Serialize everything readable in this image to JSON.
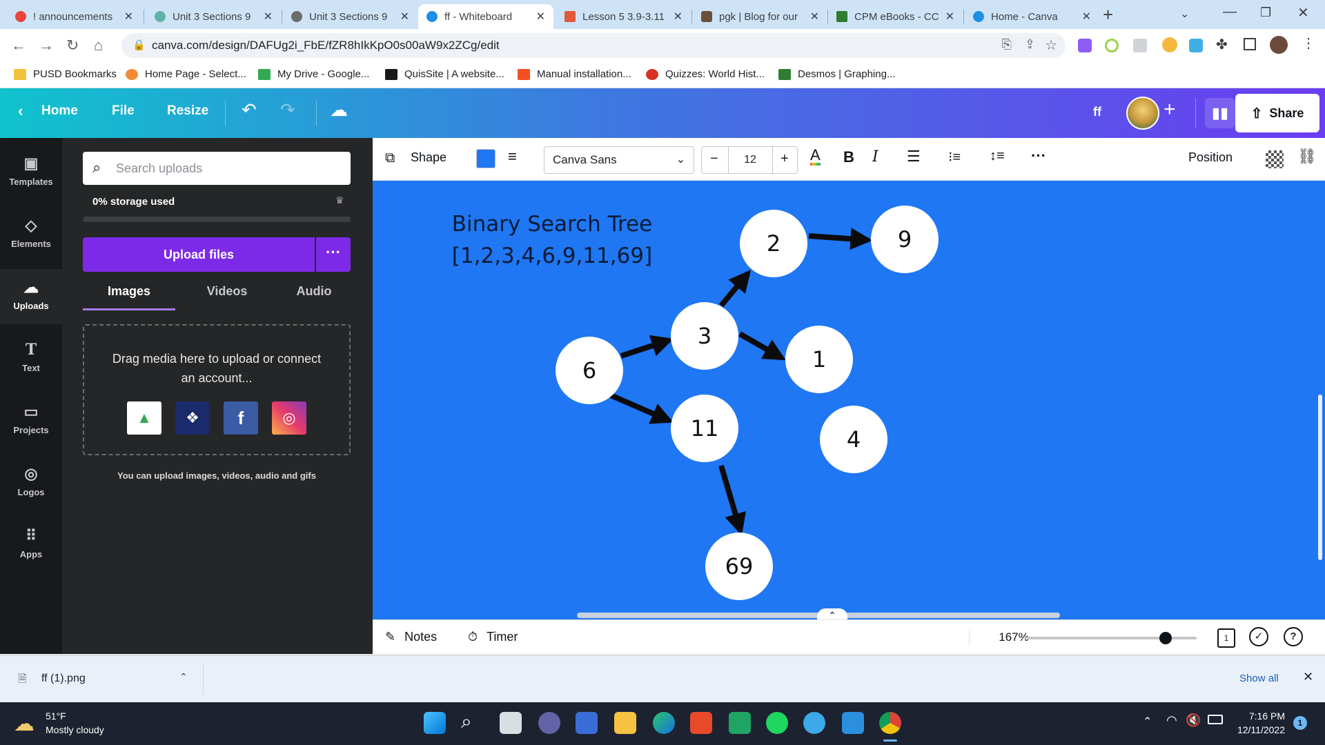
{
  "browser": {
    "tabs": [
      {
        "title": "! announcements",
        "active": false,
        "color": "#e8453c"
      },
      {
        "title": "Unit 3 Sections 9",
        "active": false,
        "color": "#5fb3a6"
      },
      {
        "title": "Unit 3 Sections 9",
        "active": false,
        "color": "#6b6b6b"
      },
      {
        "title": "ff - Whiteboard",
        "active": true,
        "color": "#1f8ee6"
      },
      {
        "title": "Lesson 5 3.9-3.11",
        "active": false,
        "color": "#e05a3a"
      },
      {
        "title": "pgk | Blog for our",
        "active": false,
        "color": "#6b4f3a"
      },
      {
        "title": "CPM eBooks - CC",
        "active": false,
        "color": "#2e7d32"
      },
      {
        "title": "Home - Canva",
        "active": false,
        "color": "#1f8ee6"
      }
    ],
    "new_tab": "+",
    "url": "canva.com/design/DAFUg2i_FbE/fZR8hIkKpO0s00aW9x2ZCg/edit",
    "bookmarks": [
      {
        "label": "PUSD Bookmarks",
        "color": "#f0c23b"
      },
      {
        "label": "Home Page - Select...",
        "color": "#f28b33"
      },
      {
        "label": "My Drive - Google...",
        "color": "#34a853"
      },
      {
        "label": "QuisSite | A website...",
        "color": "#1a1a1a"
      },
      {
        "label": "Manual installation...",
        "color": "#f25022"
      },
      {
        "label": "Quizzes: World Hist...",
        "color": "#d93025"
      },
      {
        "label": "Desmos | Graphing...",
        "color": "#2e7d32"
      }
    ]
  },
  "canva": {
    "header": {
      "home": "Home",
      "file": "File",
      "resize": "Resize",
      "doc_title": "ff",
      "share": "Share"
    },
    "rail": [
      {
        "label": "Templates",
        "icon": "templates-icon",
        "glyph": "▣"
      },
      {
        "label": "Elements",
        "icon": "elements-icon",
        "glyph": "◇"
      },
      {
        "label": "Uploads",
        "icon": "uploads-icon",
        "glyph": "☁",
        "selected": true
      },
      {
        "label": "Text",
        "icon": "text-icon",
        "glyph": "T"
      },
      {
        "label": "Projects",
        "icon": "projects-icon",
        "glyph": "▭"
      },
      {
        "label": "Logos",
        "icon": "logos-icon",
        "glyph": "◎"
      },
      {
        "label": "Apps",
        "icon": "apps-icon",
        "glyph": "⠿"
      }
    ],
    "panel": {
      "search_placeholder": "Search uploads",
      "storage": "0% storage used",
      "upload_button": "Upload files",
      "tabs": [
        "Images",
        "Videos",
        "Audio"
      ],
      "drop_text": "Drag media here to upload or connect an account...",
      "hint": "You can upload images, videos, audio and gifs"
    },
    "format_toolbar": {
      "shape_label": "Shape",
      "shape_color": "#1f77f4",
      "font": "Canva Sans",
      "font_size": "12",
      "position": "Position"
    },
    "canvas": {
      "title_line1": "Binary Search Tree",
      "title_line2": "[1,2,3,4,6,9,11,69]",
      "nodes": [
        "6",
        "3",
        "2",
        "9",
        "1",
        "11",
        "4",
        "69"
      ]
    },
    "bottom": {
      "notes": "Notes",
      "timer": "Timer",
      "zoom": "167%",
      "zoom_level": 0.82,
      "page_count": "1"
    }
  },
  "downloads": {
    "file": "ff (1).png",
    "show_all": "Show all"
  },
  "taskbar": {
    "temp": "51°F",
    "weather": "Mostly cloudy",
    "time": "7:16 PM",
    "date": "12/11/2022",
    "notifications": "1"
  }
}
